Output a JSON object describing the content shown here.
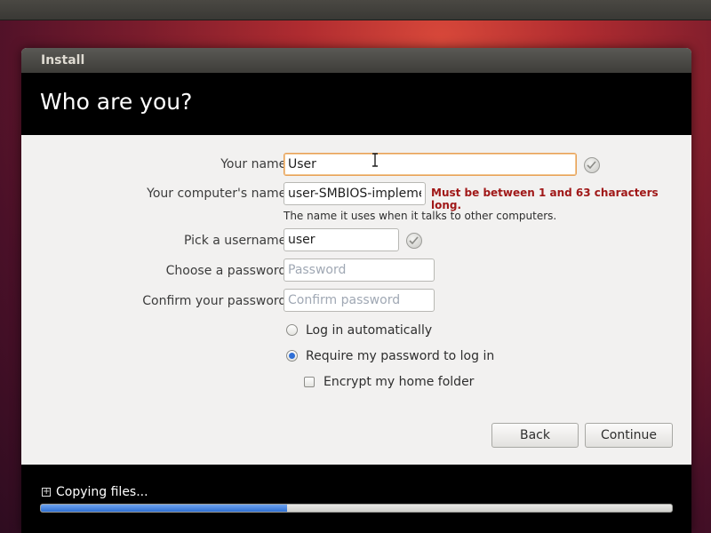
{
  "window": {
    "title": "Install",
    "heading": "Who are you?"
  },
  "form": {
    "your_name": {
      "label": "Your name:",
      "value": "User",
      "status_icon": "check-icon"
    },
    "computer_name": {
      "label": "Your computer's name:",
      "value": "user-SMBIOS-implemented",
      "error": "Must be between 1 and 63 characters long.",
      "hint": "The name it uses when it talks to other computers."
    },
    "username": {
      "label": "Pick a username:",
      "value": "user",
      "status_icon": "check-icon"
    },
    "password": {
      "label": "Choose a password:",
      "placeholder": "Password",
      "value": ""
    },
    "confirm_password": {
      "label": "Confirm your password:",
      "placeholder": "Confirm password",
      "value": ""
    }
  },
  "login_options": {
    "auto_login": {
      "label": "Log in automatically",
      "selected": false
    },
    "require_password": {
      "label": "Require my password to log in",
      "selected": true
    },
    "encrypt_home": {
      "label": "Encrypt my home folder",
      "checked": false
    }
  },
  "buttons": {
    "back": "Back",
    "continue": "Continue"
  },
  "footer": {
    "status": "Copying files...",
    "progress": 0.39,
    "expander_icon": "plus-square-icon"
  },
  "colors": {
    "error": "#a01818",
    "progress_fill": "#2d6fd2",
    "focus_border": "#e8a056"
  }
}
